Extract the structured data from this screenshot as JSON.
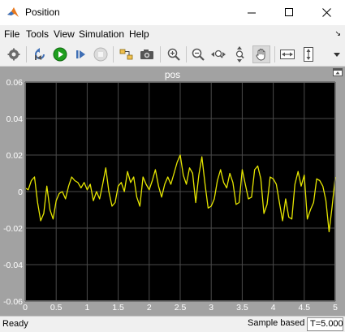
{
  "window": {
    "title": "Position"
  },
  "menu": {
    "items": [
      "File",
      "Tools",
      "View",
      "Simulation",
      "Help"
    ]
  },
  "toolbar": {
    "buttons": [
      {
        "icon": "gear-icon",
        "name": "settings-button"
      },
      {
        "icon": "step-back-icon",
        "name": "step-back-button"
      },
      {
        "icon": "run-icon",
        "name": "run-button"
      },
      {
        "icon": "step-forward-icon",
        "name": "step-forward-button"
      },
      {
        "icon": "stop-icon",
        "name": "stop-button"
      },
      {
        "icon": "highlight-block-icon",
        "name": "highlight-block-button"
      },
      {
        "icon": "snapshot-icon",
        "name": "snapshot-button"
      },
      {
        "icon": "zoom-in-icon",
        "name": "zoom-in-button"
      },
      {
        "icon": "zoom-out-icon",
        "name": "zoom-out-button"
      },
      {
        "icon": "zoom-x-icon",
        "name": "zoom-x-button"
      },
      {
        "icon": "zoom-y-icon",
        "name": "zoom-y-button"
      },
      {
        "icon": "pan-icon",
        "name": "pan-button"
      },
      {
        "icon": "scale-x-icon",
        "name": "scale-x-button"
      },
      {
        "icon": "scale-y-icon",
        "name": "scale-y-button"
      },
      {
        "icon": "dropdown-icon",
        "name": "toolbar-more-button"
      }
    ]
  },
  "status": {
    "ready": "Ready",
    "mode": "Sample based",
    "time": "T=5.000"
  },
  "colors": {
    "trace": "#e6e600",
    "plot_bg": "#000000",
    "frame_bg": "#a2a2a2",
    "grid": "#4a4a4a",
    "run_green": "#1e9e1e",
    "matlab_orange": "#e8791e"
  },
  "chart_data": {
    "type": "line",
    "title": "pos",
    "xlim": [
      0,
      5
    ],
    "ylim": [
      -0.06,
      0.06
    ],
    "xticks": [
      "0",
      "0.5",
      "1",
      "1.5",
      "2",
      "2.5",
      "3",
      "3.5",
      "4",
      "4.5",
      "5"
    ],
    "yticks": [
      "0.06",
      "0.04",
      "0.02",
      "0",
      "-0.02",
      "-0.04",
      "-0.06"
    ],
    "grid": true,
    "series": [
      {
        "x": [
          0.0,
          0.05,
          0.1,
          0.15,
          0.2,
          0.25,
          0.3,
          0.35,
          0.4,
          0.45,
          0.5,
          0.55,
          0.6,
          0.65,
          0.7,
          0.75,
          0.8,
          0.85,
          0.9,
          0.95,
          1.0,
          1.05,
          1.1,
          1.15,
          1.2,
          1.25,
          1.3,
          1.35,
          1.4,
          1.45,
          1.5,
          1.55,
          1.6,
          1.65,
          1.7,
          1.75,
          1.8,
          1.85,
          1.9,
          1.95,
          2.0,
          2.05,
          2.1,
          2.15,
          2.2,
          2.25,
          2.3,
          2.35,
          2.4,
          2.45,
          2.5,
          2.55,
          2.6,
          2.65,
          2.7,
          2.75,
          2.8,
          2.85,
          2.9,
          2.95,
          3.0,
          3.05,
          3.1,
          3.15,
          3.2,
          3.25,
          3.3,
          3.35,
          3.4,
          3.45,
          3.5,
          3.55,
          3.6,
          3.65,
          3.7,
          3.75,
          3.8,
          3.85,
          3.9,
          3.95,
          4.0,
          4.05,
          4.1,
          4.15,
          4.2,
          4.25,
          4.3,
          4.35,
          4.4,
          4.45,
          4.5,
          4.55,
          4.6,
          4.65,
          4.7,
          4.75,
          4.8,
          4.85,
          4.9,
          4.95,
          5.0
        ],
        "y": [
          0.002,
          0.001,
          0.006,
          0.008,
          -0.006,
          -0.016,
          -0.012,
          0.003,
          -0.01,
          -0.015,
          -0.005,
          -0.001,
          0.0,
          -0.004,
          0.003,
          0.008,
          0.006,
          0.005,
          0.002,
          0.005,
          0.001,
          0.004,
          -0.005,
          0.0,
          -0.004,
          0.004,
          0.013,
          0.0,
          -0.008,
          -0.006,
          0.003,
          0.005,
          0.0,
          0.011,
          0.005,
          0.008,
          -0.003,
          -0.008,
          0.008,
          0.004,
          0.001,
          0.006,
          0.012,
          0.003,
          -0.003,
          0.004,
          0.008,
          0.004,
          0.01,
          0.016,
          0.02,
          0.009,
          0.004,
          0.013,
          0.01,
          -0.006,
          0.009,
          0.019,
          0.004,
          -0.009,
          -0.008,
          -0.004,
          0.006,
          0.012,
          0.005,
          0.002,
          0.01,
          0.005,
          -0.007,
          -0.006,
          0.012,
          0.004,
          -0.004,
          -0.003,
          0.012,
          0.014,
          0.007,
          -0.012,
          -0.007,
          0.008,
          0.007,
          0.004,
          -0.006,
          -0.016,
          -0.004,
          -0.014,
          -0.015,
          0.004,
          0.011,
          0.003,
          0.009,
          -0.015,
          -0.01,
          -0.006,
          0.007,
          0.006,
          0.003,
          -0.005,
          -0.022,
          -0.008,
          0.008
        ]
      }
    ]
  }
}
